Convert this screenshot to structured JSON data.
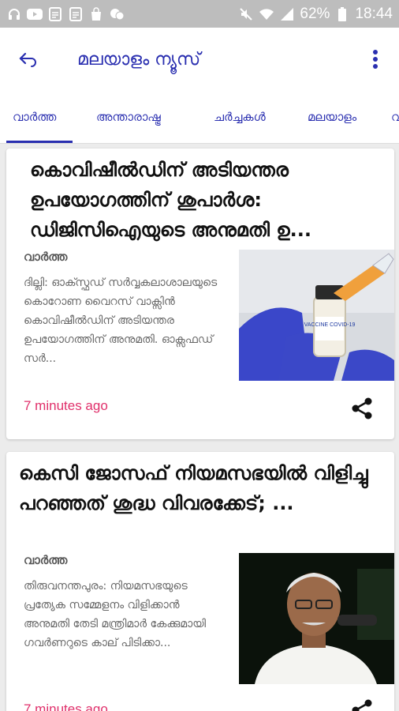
{
  "status_bar": {
    "battery": "62%",
    "time": "18:44"
  },
  "app_bar": {
    "title": "മലയാളം ന്യൂസ്"
  },
  "tabs": [
    {
      "label": "വാർത്ത"
    },
    {
      "label": "അന്താരാഷ്ട്ര"
    },
    {
      "label": "ചർച്ചകൾ"
    },
    {
      "label": "മലയാളം"
    },
    {
      "label": "വ"
    }
  ],
  "articles": [
    {
      "title": "കൊവിഷീൽഡിന് അടിയന്തര ഉപയോഗത്തിന് ശുപാർശ: ഡിജിസിഐയുടെ അനുമതി ഉ...",
      "category": "വാർത്ത",
      "snippet": "ദില്ലി: ഓക്സ്ഫഡ് സർവ്വകലാശാലയുടെ കൊറോണ വൈറസ് വാക്സിൻ കൊവിഷീൽഡിന് അടിയന്തര ഉപയോഗത്തിന് അനുമതി. ഓക്സഫഡ് സർ...",
      "time": "7 minutes ago",
      "vial_label": "VACCINE COVID-19"
    },
    {
      "title": "കെസി ജോസഫ് നിയമസഭയിൽ വിളിച്ചു പറഞ്ഞത് ശുദ്ധ വിവരക്കേട്; ...",
      "category": "വാർത്ത",
      "snippet": "തിരുവനന്തപുരം: നിയമസഭയുടെ പ്രത്യേക സമ്മേളനം വിളിക്കാൻ അനുമതി തേടി മന്ത്രിമാർ കേക്കുമായി ഗവർണറുടെ കാല് പിടിക്കാ...",
      "time": "7 minutes ago"
    }
  ]
}
